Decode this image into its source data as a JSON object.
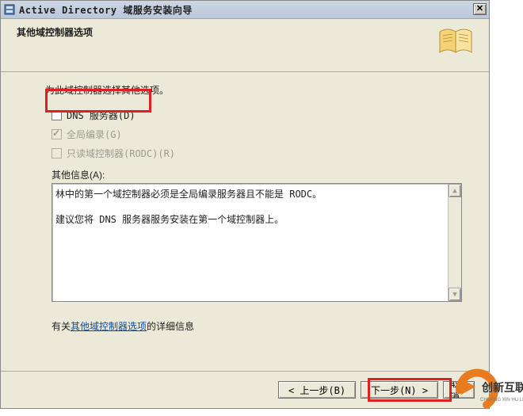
{
  "window": {
    "title": "Active Directory 域服务安装向导"
  },
  "header": {
    "heading": "其他域控制器选项"
  },
  "body": {
    "instruction": "为此域控制器选择其他选项。",
    "options": {
      "dns": {
        "label": "DNS 服务器(D)",
        "checked": false,
        "enabled": true
      },
      "gc": {
        "label": "全局编录(G)",
        "checked": true,
        "enabled": false
      },
      "rodc": {
        "label": "只读域控制器(RODC)(R)",
        "checked": false,
        "enabled": false
      }
    },
    "info_label": "其他信息(A):",
    "info_text_line1": "林中的第一个域控制器必须是全局编录服务器且不能是 RODC。",
    "info_text_line2": "建议您将 DNS 服务器服务安装在第一个域控制器上。",
    "more_prefix": "有关",
    "more_link": "其他域控制器选项",
    "more_suffix": "的详细信息"
  },
  "buttons": {
    "back": "< 上一步(B)",
    "next": "下一步(N) >",
    "cancel": "取消"
  },
  "watermark": {
    "brand_zh": "创新互联",
    "brand_py": "CHUANG XIN HU LIAN"
  }
}
